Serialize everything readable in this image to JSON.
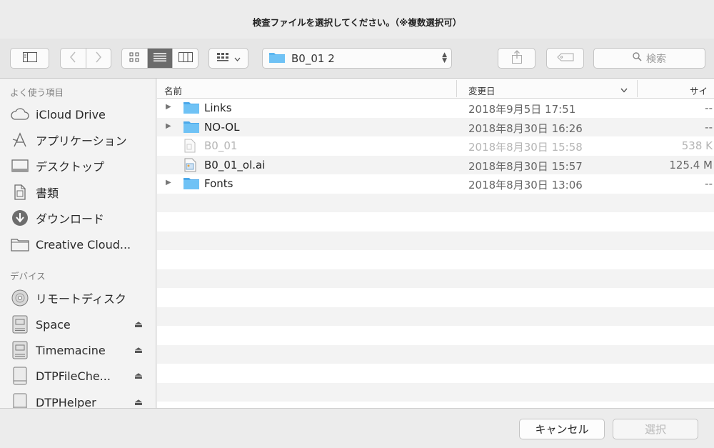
{
  "window": {
    "title": "検査ファイルを選択してください。（※複数選択可）"
  },
  "toolbar": {
    "sidebar_toggle_icon": "sidebar-icon",
    "back_icon": "chevron-left-icon",
    "forward_icon": "chevron-right-icon",
    "view_modes": [
      "icon-view-icon",
      "list-view-icon",
      "column-view-icon"
    ],
    "active_view": "list",
    "group_icon": "group-view-icon",
    "path": "B0_01 2",
    "share_icon": "share-icon",
    "tag_icon": "tag-icon",
    "search_placeholder": "検索"
  },
  "sidebar": {
    "favorites_header": "よく使う項目",
    "favorites": [
      {
        "label": "iCloud Drive",
        "icon": "cloud-icon"
      },
      {
        "label": "アプリケーション",
        "icon": "applications-icon"
      },
      {
        "label": "デスクトップ",
        "icon": "desktop-icon"
      },
      {
        "label": "書類",
        "icon": "documents-icon"
      },
      {
        "label": "ダウンロード",
        "icon": "download-icon"
      },
      {
        "label": "Creative Cloud...",
        "icon": "folder-icon"
      }
    ],
    "devices_header": "デバイス",
    "devices": [
      {
        "label": "リモートディスク",
        "icon": "disc-icon",
        "eject": false
      },
      {
        "label": "Space",
        "icon": "drive-icon",
        "eject": true
      },
      {
        "label": "Timemacine",
        "icon": "drive-icon",
        "eject": true
      },
      {
        "label": "DTPFileChe...",
        "icon": "removable-drive-icon",
        "eject": true
      },
      {
        "label": "DTPHelper",
        "icon": "removable-drive-icon",
        "eject": true
      }
    ]
  },
  "list": {
    "columns": {
      "name": "名前",
      "date": "変更日",
      "size": "サイ"
    },
    "rows": [
      {
        "name": "Links",
        "date": "2018年9月5日 17:51",
        "size": "--",
        "kind": "folder",
        "dim": false
      },
      {
        "name": "NO-OL",
        "date": "2018年8月30日 16:26",
        "size": "--",
        "kind": "folder",
        "dim": false
      },
      {
        "name": "B0_01",
        "date": "2018年8月30日 15:58",
        "size": "538 K",
        "kind": "file",
        "dim": true
      },
      {
        "name": "B0_01_ol.ai",
        "date": "2018年8月30日 15:57",
        "size": "125.4 M",
        "kind": "ai-file",
        "dim": false
      },
      {
        "name": "Fonts",
        "date": "2018年8月30日 13:06",
        "size": "--",
        "kind": "folder",
        "dim": false
      }
    ]
  },
  "buttons": {
    "cancel": "キャンセル",
    "select": "選択"
  },
  "colors": {
    "folder": "#5ab6f0",
    "active_segment": "#6b6b6b"
  }
}
